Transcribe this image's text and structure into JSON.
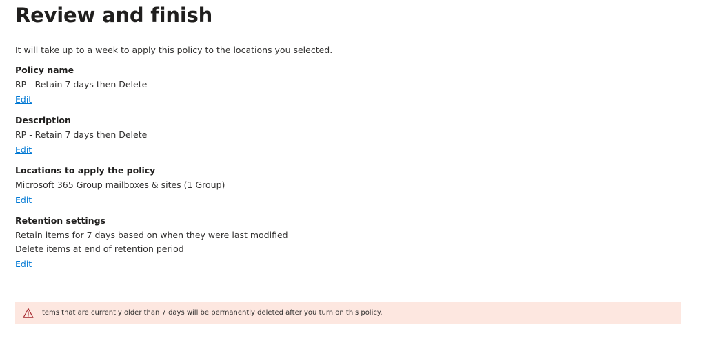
{
  "page": {
    "title": "Review and finish",
    "intro": "It will take up to a week to apply this policy to the locations you selected."
  },
  "sections": [
    {
      "heading": "Policy name",
      "values": [
        "RP - Retain 7 days then Delete"
      ],
      "edit_label": "Edit"
    },
    {
      "heading": "Description",
      "values": [
        "RP - Retain 7 days then Delete"
      ],
      "edit_label": "Edit"
    },
    {
      "heading": "Locations to apply the policy",
      "values": [
        "Microsoft 365 Group mailboxes & sites (1 Group)"
      ],
      "edit_label": "Edit"
    },
    {
      "heading": "Retention settings",
      "values": [
        "Retain items for 7 days based on when they were last modified",
        "Delete items at end of retention period"
      ],
      "edit_label": "Edit"
    }
  ],
  "warning": {
    "icon": "warning-icon",
    "text": "Items that are currently older than 7 days will be permanently deleted after you turn on this policy.",
    "background_color": "#fde7e0",
    "icon_color": "#a4262c"
  },
  "colors": {
    "link": "#0078d4"
  }
}
